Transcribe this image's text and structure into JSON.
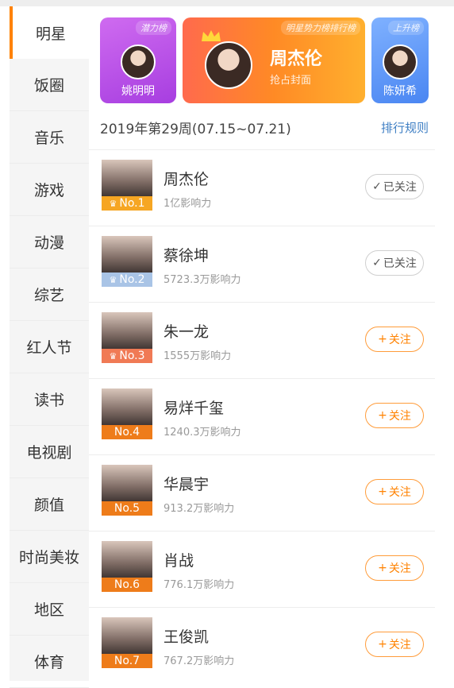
{
  "sidebar": {
    "items": [
      {
        "label": "明星",
        "active": true
      },
      {
        "label": "饭圈"
      },
      {
        "label": "音乐"
      },
      {
        "label": "游戏"
      },
      {
        "label": "动漫"
      },
      {
        "label": "综艺"
      },
      {
        "label": "红人节"
      },
      {
        "label": "读书"
      },
      {
        "label": "电视剧"
      },
      {
        "label": "颜值"
      },
      {
        "label": "时尚美妆"
      },
      {
        "label": "地区"
      },
      {
        "label": "体育"
      }
    ]
  },
  "banners": {
    "left": {
      "tag": "潜力榜",
      "name": "姚明明"
    },
    "center": {
      "tag": "明星势力榜排行榜",
      "name": "周杰伦",
      "subtitle": "抢占封面"
    },
    "right": {
      "tag": "上升榜",
      "name": "陈妍希"
    }
  },
  "week": {
    "label": "2019年第29周(07.15~07.21)",
    "rules_label": "排行规则"
  },
  "ranking": [
    {
      "rank": "No.1",
      "name": "周杰伦",
      "influence": "1亿影响力",
      "button": "已关注",
      "followed": true
    },
    {
      "rank": "No.2",
      "name": "蔡徐坤",
      "influence": "5723.3万影响力",
      "button": "已关注",
      "followed": true
    },
    {
      "rank": "No.3",
      "name": "朱一龙",
      "influence": "1555万影响力",
      "button": "关注",
      "followed": false
    },
    {
      "rank": "No.4",
      "name": "易烊千玺",
      "influence": "1240.3万影响力",
      "button": "关注",
      "followed": false
    },
    {
      "rank": "No.5",
      "name": "华晨宇",
      "influence": "913.2万影响力",
      "button": "关注",
      "followed": false
    },
    {
      "rank": "No.6",
      "name": "肖战",
      "influence": "776.1万影响力",
      "button": "关注",
      "followed": false
    },
    {
      "rank": "No.7",
      "name": "王俊凯",
      "influence": "767.2万影响力",
      "button": "关注",
      "followed": false
    }
  ],
  "colors": {
    "accent": "#ff8200",
    "rank1": "#f6a623",
    "rank2": "#a9c4e6",
    "rank3": "#f07a55",
    "rank_other": "#ee7c1a",
    "link": "#3f7fc4"
  },
  "icons": {
    "crown": "crown-icon",
    "check": "checkmark-icon",
    "plus": "plus-icon"
  }
}
